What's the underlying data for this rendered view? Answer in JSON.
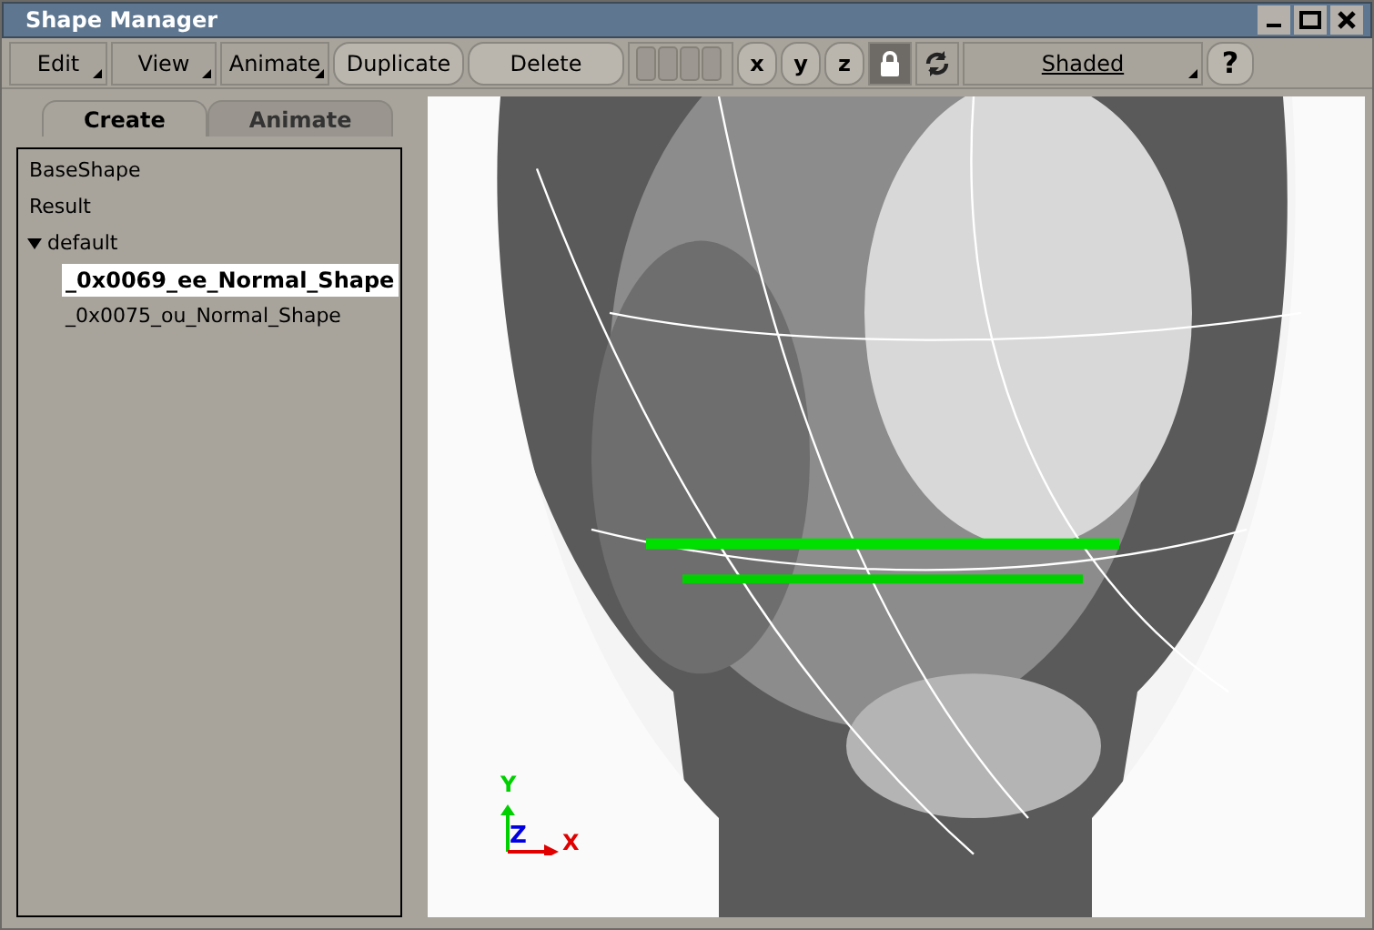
{
  "window": {
    "title": "Shape Manager"
  },
  "toolbar": [
    {
      "kind": "menu",
      "label": "Edit"
    },
    {
      "kind": "menu",
      "label": "View"
    },
    {
      "kind": "menu",
      "label": "Animate"
    },
    {
      "kind": "button",
      "label": "Duplicate"
    },
    {
      "kind": "button",
      "label": "Delete"
    },
    {
      "kind": "slots"
    },
    {
      "kind": "axis",
      "label": "x"
    },
    {
      "kind": "axis",
      "label": "y"
    },
    {
      "kind": "axis",
      "label": "z"
    },
    {
      "kind": "lock",
      "on": true
    },
    {
      "kind": "refresh"
    },
    {
      "kind": "dropdown",
      "label": "Shaded"
    },
    {
      "kind": "help",
      "label": "?"
    }
  ],
  "tabs": [
    {
      "label": "Create",
      "selected": true
    },
    {
      "label": "Animate",
      "selected": false
    }
  ],
  "tree": [
    {
      "label": "BaseShape",
      "selected": false
    },
    {
      "label": "Result",
      "selected": false
    },
    {
      "label": "default",
      "selected": false,
      "expanded": true,
      "children": [
        {
          "label": "_0x0069_ee_Normal_Shape",
          "selected": true
        },
        {
          "label": "_0x0075_ou_Normal_Shape",
          "selected": false
        }
      ]
    }
  ],
  "viewport": {
    "axes": {
      "y": "Y",
      "z": "Z",
      "x": "X"
    }
  }
}
